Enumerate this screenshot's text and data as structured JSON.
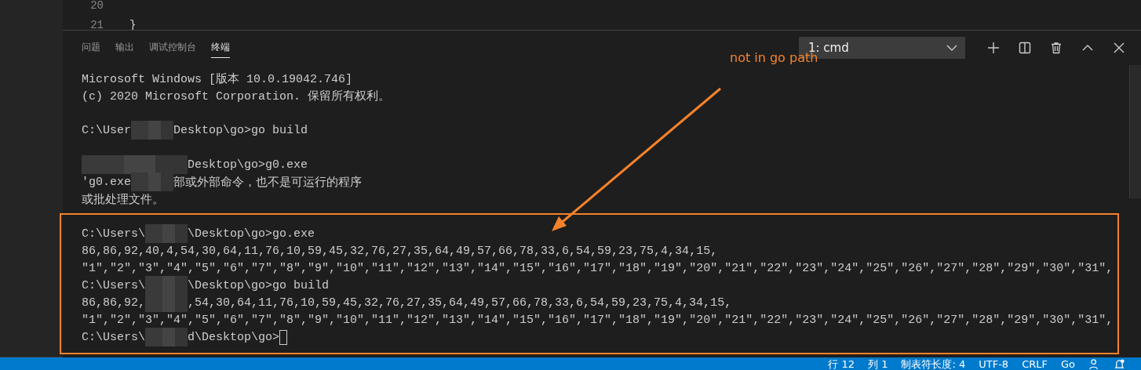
{
  "editor": {
    "lines": [
      {
        "number": "20"
      },
      {
        "number": "21",
        "text": "}"
      }
    ]
  },
  "panel": {
    "tabs": [
      {
        "label": "问题",
        "selected": false
      },
      {
        "label": "输出",
        "selected": false
      },
      {
        "label": "调试控制台",
        "selected": false
      },
      {
        "label": "终端",
        "selected": true
      }
    ],
    "terminal_select": {
      "value": "1: cmd"
    }
  },
  "terminal": {
    "lines": [
      {
        "kind": "text",
        "segments": [
          {
            "kind": "text",
            "text": "Microsoft Windows [版本 10.0.19042.746]"
          }
        ]
      },
      {
        "kind": "text",
        "segments": [
          {
            "kind": "text",
            "text": "(c) 2020 Microsoft Corporation. 保留所有权利。"
          }
        ]
      },
      {
        "kind": "blank"
      },
      {
        "kind": "text",
        "segments": [
          {
            "kind": "text",
            "text": "C:\\User"
          },
          {
            "kind": "redaction",
            "wide": false
          },
          {
            "kind": "text",
            "text": "Desktop\\go>go build"
          }
        ]
      },
      {
        "kind": "blank"
      },
      {
        "kind": "text",
        "segments": [
          {
            "kind": "redaction",
            "wide": true
          },
          {
            "kind": "text",
            "text": "Desktop\\go>g0.exe"
          }
        ]
      },
      {
        "kind": "text",
        "segments": [
          {
            "kind": "text",
            "text": "'g0.exe"
          },
          {
            "kind": "redaction",
            "wide": false
          },
          {
            "kind": "text",
            "text": "部或外部命令，也不是可运行的程序"
          }
        ]
      },
      {
        "kind": "text",
        "segments": [
          {
            "kind": "text",
            "text": "或批处理文件。"
          }
        ]
      },
      {
        "kind": "blank"
      },
      {
        "kind": "text",
        "segments": [
          {
            "kind": "text",
            "text": "C:\\Users\\"
          },
          {
            "kind": "redaction",
            "wide": false
          },
          {
            "kind": "text",
            "text": "\\Desktop\\go>go.exe"
          }
        ]
      },
      {
        "kind": "text",
        "segments": [
          {
            "kind": "text",
            "text": "86,86,92,40,4,54,30,64,11,76,10,59,45,32,76,27,35,64,49,57,66,78,33,6,54,59,23,75,4,34,15,"
          }
        ]
      },
      {
        "kind": "text",
        "segments": [
          {
            "kind": "text",
            "text": "\"1\",\"2\",\"3\",\"4\",\"5\",\"6\",\"7\",\"8\",\"9\",\"10\",\"11\",\"12\",\"13\",\"14\",\"15\",\"16\",\"17\",\"18\",\"19\",\"20\",\"21\",\"22\",\"23\",\"24\",\"25\",\"26\",\"27\",\"28\",\"29\",\"30\",\"31\","
          }
        ]
      },
      {
        "kind": "text",
        "segments": [
          {
            "kind": "text",
            "text": "C:\\Users\\"
          },
          {
            "kind": "redaction",
            "wide": false
          },
          {
            "kind": "text",
            "text": "\\Desktop\\go>go build"
          }
        ]
      },
      {
        "kind": "text",
        "segments": [
          {
            "kind": "text",
            "text": "86,86,92,"
          },
          {
            "kind": "redaction",
            "wide": false
          },
          {
            "kind": "text",
            "text": ",54,30,64,11,76,10,59,45,32,76,27,35,64,49,57,66,78,33,6,54,59,23,75,4,34,15,"
          }
        ]
      },
      {
        "kind": "text",
        "segments": [
          {
            "kind": "text",
            "text": "\"1\",\"2\",\"3\",\"4\",\"5\",\"6\",\"7\",\"8\",\"9\",\"10\",\"11\",\"12\",\"13\",\"14\",\"15\",\"16\",\"17\",\"18\",\"19\",\"20\",\"21\",\"22\",\"23\",\"24\",\"25\",\"26\",\"27\",\"28\",\"29\",\"30\",\"31\","
          }
        ]
      },
      {
        "kind": "prompt",
        "cursor": true,
        "segments": [
          {
            "kind": "text",
            "text": "C:\\Users\\"
          },
          {
            "kind": "redaction",
            "wide": false
          },
          {
            "kind": "text",
            "text": "d\\Desktop\\go>"
          }
        ]
      }
    ]
  },
  "annotation": {
    "text": "not in go path"
  },
  "status_bar": {
    "items": [
      "行 12",
      "列 1",
      "制表符长度: 4",
      "UTF-8",
      "CRLF",
      "Go"
    ]
  }
}
